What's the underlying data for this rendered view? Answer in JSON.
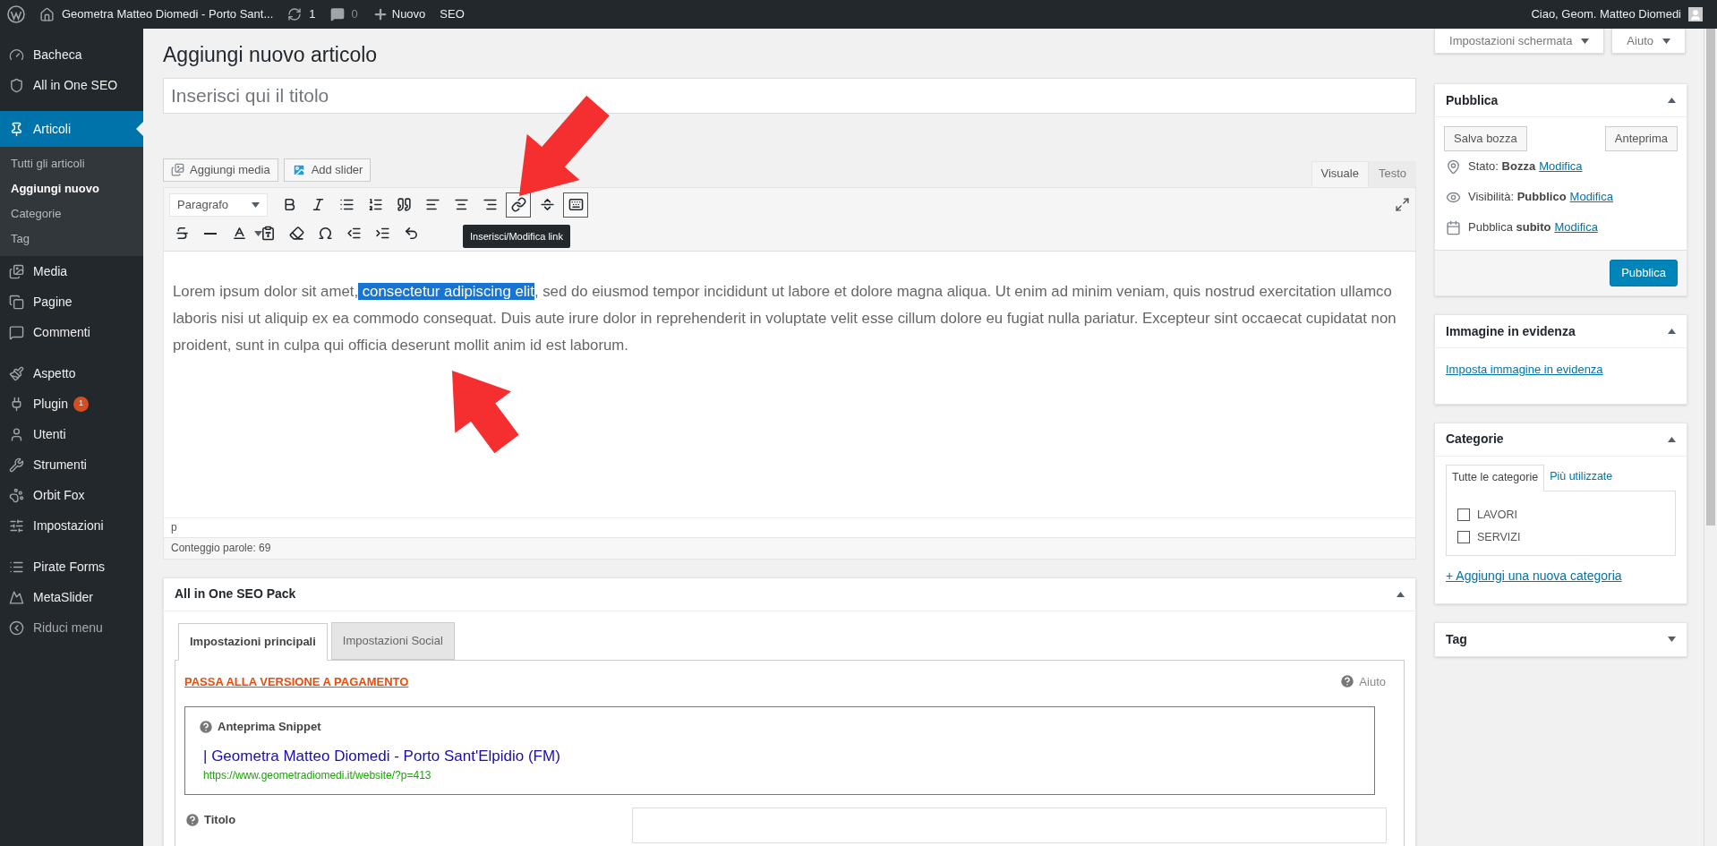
{
  "admin_bar": {
    "site": "Geometra Matteo Diomedi - Porto Sant...",
    "updates": "1",
    "comments": "0",
    "new": "Nuovo",
    "seo": "SEO",
    "greeting": "Ciao, Geom. Matteo Diomedi"
  },
  "sidebar": {
    "groups": [
      [
        {
          "kind": "dashboard",
          "label": "Bacheca",
          "selected": false
        },
        {
          "kind": "seo",
          "label": "All in One SEO",
          "selected": false
        }
      ],
      [
        {
          "kind": "posts",
          "label": "Articoli",
          "selected": true,
          "children": [
            {
              "label": "Tutti gli articoli",
              "selected": false
            },
            {
              "label": "Aggiungi nuovo",
              "selected": true
            },
            {
              "label": "Categorie",
              "selected": false
            },
            {
              "label": "Tag",
              "selected": false
            }
          ]
        },
        {
          "kind": "media",
          "label": "Media",
          "selected": false
        },
        {
          "kind": "pages",
          "label": "Pagine",
          "selected": false
        },
        {
          "kind": "comments",
          "label": "Commenti",
          "selected": false
        }
      ],
      [
        {
          "kind": "appearance",
          "label": "Aspetto",
          "selected": false
        },
        {
          "kind": "plugins",
          "label": "Plugin",
          "selected": false,
          "badge": "1"
        },
        {
          "kind": "users",
          "label": "Utenti",
          "selected": false
        },
        {
          "kind": "tools",
          "label": "Strumenti",
          "selected": false
        },
        {
          "kind": "fox",
          "label": "Orbit Fox",
          "selected": false
        },
        {
          "kind": "settings",
          "label": "Impostazioni",
          "selected": false
        }
      ],
      [
        {
          "kind": "forms",
          "label": "Pirate Forms",
          "selected": false
        },
        {
          "kind": "slider",
          "label": "MetaSlider",
          "selected": false
        },
        {
          "kind": "collapse",
          "label": "Riduci menu",
          "selected": false
        }
      ]
    ]
  },
  "screen_options": [
    "Impostazioni schermata",
    "Aiuto"
  ],
  "page_title": "Aggiungi nuovo articolo",
  "title_field": {
    "placeholder": "Inserisci qui il titolo"
  },
  "media_buttons": [
    {
      "kind": "media",
      "label": "Aggiungi media"
    },
    {
      "kind": "slider",
      "label": "Add slider"
    }
  ],
  "editor_tabs": [
    {
      "label": "Visuale",
      "selected": true
    },
    {
      "label": "Testo",
      "selected": false
    }
  ],
  "toolbar": {
    "format": "Paragrafo",
    "tooltip": "Inserisci/Modifica link",
    "rows": [
      [
        {
          "kind": "bold",
          "active": false
        },
        {
          "kind": "italic",
          "active": false
        },
        {
          "kind": "bullets",
          "active": false
        },
        {
          "kind": "numbers",
          "active": false
        },
        {
          "kind": "quote",
          "active": false
        },
        {
          "kind": "align_left",
          "active": false
        },
        {
          "kind": "align_center",
          "active": false
        },
        {
          "kind": "align_right",
          "active": false
        },
        {
          "kind": "link",
          "active": true
        },
        {
          "kind": "more",
          "active": false
        },
        {
          "kind": "toggle",
          "active": true
        }
      ],
      [
        {
          "kind": "strike",
          "active": false
        },
        {
          "kind": "hr",
          "active": false
        },
        {
          "kind": "text_color",
          "active": false
        },
        {
          "kind": "paste_text",
          "active": false
        },
        {
          "kind": "clear",
          "active": false
        },
        {
          "kind": "omega",
          "active": false
        },
        {
          "kind": "outdent",
          "active": false
        },
        {
          "kind": "indent",
          "active": false
        },
        {
          "kind": "undo",
          "active": false
        }
      ]
    ]
  },
  "content": [
    {
      "text": "Lorem ipsum dolor sit amet,",
      "selected": false
    },
    {
      "text": " consectetur adipiscing elit",
      "selected": true
    },
    {
      "text": ", sed do eiusmod tempor incididunt ut labore et dolore magna aliqua. Ut enim ad minim veniam, quis nostrud exercitation ullamco laboris nisi ut aliquip ex ea commodo consequat. Duis aute irure dolor in reprehenderit in voluptate velit esse cillum dolore eu fugiat nulla pariatur. Excepteur sint occaecat cupidatat non proident, sunt in culpa qui officia deserunt mollit anim id est laborum.",
      "selected": false
    }
  ],
  "path": "p",
  "word_count": "Conteggio parole: 69",
  "seo_pack": {
    "title": "All in One SEO Pack",
    "expanded": true,
    "tabs": [
      {
        "label": "Impostazioni principali",
        "selected": true
      },
      {
        "label": "Impostazioni Social",
        "selected": false
      }
    ],
    "upgrade_link": "PASSA ALLA VERSIONE A PAGAMENTO",
    "help": "Aiuto",
    "snippet": {
      "label": "Anteprima Snippet",
      "title": "| Geometra Matteo Diomedi - Porto Sant'Elpidio (FM)",
      "url": "https://www.geometradiomedi.it/website/?p=413"
    },
    "field_label": "Titolo"
  },
  "publish": {
    "title": "Pubblica",
    "expanded": true,
    "save": "Salva bozza",
    "preview": "Anteprima",
    "rows": [
      {
        "kind": "status",
        "label": "Stato:",
        "value": "Bozza",
        "link": "Modifica"
      },
      {
        "kind": "visibility",
        "label": "Visibilità:",
        "value": "Pubblico",
        "link": "Modifica"
      },
      {
        "kind": "schedule",
        "label": "Pubblica",
        "value": "subito",
        "link": "Modifica"
      }
    ],
    "button": "Pubblica"
  },
  "featured_image": {
    "title": "Immagine in evidenza",
    "expanded": true,
    "link": "Imposta immagine in evidenza"
  },
  "categories": {
    "title": "Categorie",
    "expanded": true,
    "tabs": [
      {
        "label": "Tutte le categorie",
        "selected": true
      },
      {
        "label": "Più utilizzate",
        "selected": false
      }
    ],
    "items": [
      {
        "label": "LAVORI",
        "checked": false
      },
      {
        "label": "SERVIZI",
        "checked": false
      }
    ],
    "add_link": "+ Aggiungi una nuova categoria"
  },
  "tags": {
    "title": "Tag",
    "expanded": false
  }
}
